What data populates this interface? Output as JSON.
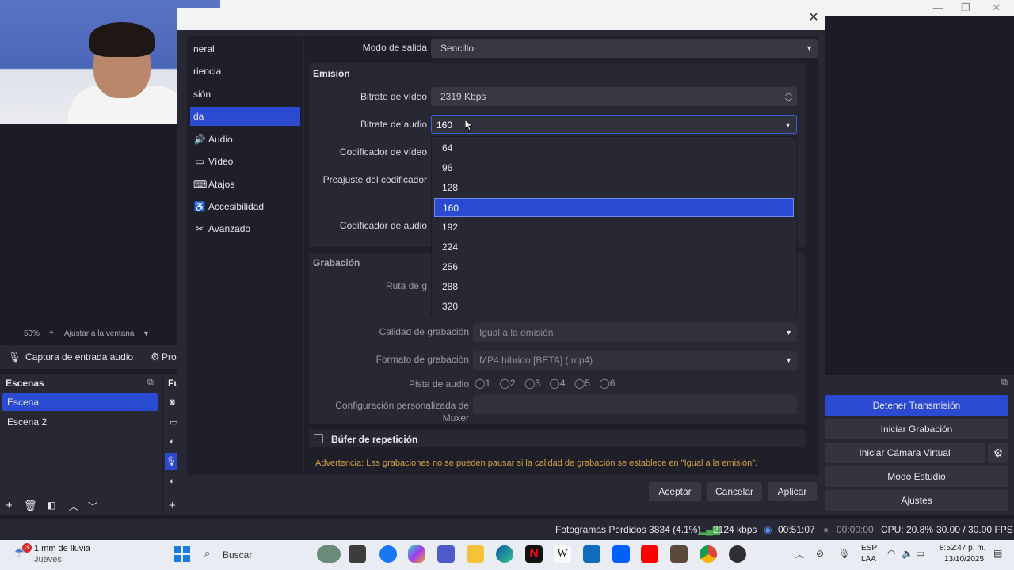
{
  "colors": {
    "accent": "#2a4bd1",
    "warning": "#d0a043",
    "panel": "#272834",
    "bg": "#1e1f29"
  },
  "preview_bar": {
    "zoom_minus": "−",
    "zoom": "50%",
    "zoom_plus": "+",
    "fit": "Ajustar a la ventana"
  },
  "source_toolbar": {
    "source_name": "Captura de entrada audio",
    "properties": "Prop"
  },
  "scenes": {
    "title": "Escenas",
    "items": [
      "Escena",
      "Escena 2"
    ],
    "selected_index": 0
  },
  "sources": {
    "title": "Fu"
  },
  "controls": {
    "stop_stream": "Detener Transmisión",
    "start_recording": "Iniciar Grabación",
    "start_virtual_cam": "Iniciar Cámara Virtual",
    "studio_mode": "Modo Estudio",
    "settings": "Ajustes"
  },
  "status": {
    "dropped_frames": "Fotogramas Perdidos 3834 (4.1%)",
    "bitrate": "2124 kbps",
    "stream_time": "00:51:07",
    "rec_time": "00:00:00",
    "cpu": "CPU: 20.8%",
    "fps": "30.00 / 30.00 FPS"
  },
  "dialog": {
    "close": "✕",
    "nav": [
      {
        "label": "neral",
        "icon": "gear-icon"
      },
      {
        "label": "riencia",
        "icon": "appearance-icon"
      },
      {
        "label": "sión",
        "icon": "stream-icon"
      },
      {
        "label": "da",
        "icon": "output-icon"
      },
      {
        "label": "Audio",
        "icon": "speaker-icon"
      },
      {
        "label": "Vídeo",
        "icon": "monitor-icon"
      },
      {
        "label": "Atajos",
        "icon": "keyboard-icon"
      },
      {
        "label": "Accesibilidad",
        "icon": "accessibility-icon"
      },
      {
        "label": "Avanzado",
        "icon": "tools-icon"
      }
    ],
    "nav_selected_index": 3,
    "output_mode_label": "Modo de salida",
    "output_mode_value": "Sencillo",
    "streaming_title": "Emisión",
    "video_bitrate_label": "Bitrate de vídeo",
    "video_bitrate_value": "2319 Kbps",
    "audio_bitrate_label": "Bitrate de audio",
    "audio_bitrate_value": "160",
    "video_encoder_label": "Codificador de vídeo",
    "encoder_preset_label": "Preajuste del codificador",
    "audio_encoder_label": "Codificador de audio",
    "recording_title": "Grabación",
    "recording_path_label": "Ruta de g",
    "recording_quality_label": "Calidad de grabación",
    "recording_quality_value": "Igual a la emisión",
    "recording_format_label": "Formato de grabación",
    "recording_format_value": "MP4 híbrido [BETA] (.mp4)",
    "audio_track_label": "Pista de audio",
    "audio_tracks": [
      "1",
      "2",
      "3",
      "4",
      "5",
      "6"
    ],
    "muxer_label": "Configuración personalizada de Muxer",
    "muxer_value": "",
    "replay_buffer_label": "Búfer de repetición",
    "warning": "Advertencia: Las grabaciones no se pueden pausar si la calidad de grabación se establece en \"Igual a la emisión\".",
    "ok": "Aceptar",
    "cancel": "Cancelar",
    "apply": "Aplicar",
    "dropdown_options": [
      "64",
      "96",
      "128",
      "160",
      "192",
      "224",
      "256",
      "288",
      "320"
    ],
    "dropdown_selected_index": 3
  },
  "taskbar": {
    "weather_badge": "3",
    "weather_text": "1 mm de lluvia",
    "weather_day": "Jueves",
    "search_placeholder": "Buscar",
    "lang_top": "ESP",
    "lang_bottom": "LAA",
    "time": "8:52:47 p. m.",
    "date": "13/10/2025"
  }
}
